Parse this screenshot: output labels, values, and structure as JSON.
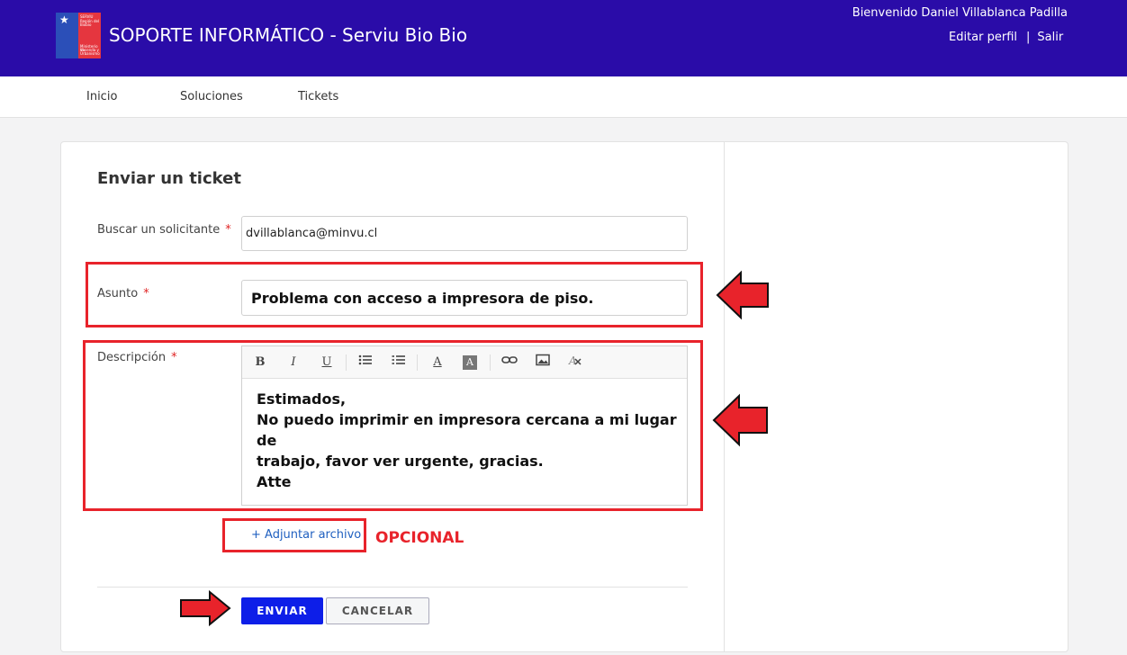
{
  "header": {
    "title": "SOPORTE INFORMÁTICO - Serviu Bio Bio",
    "welcome": "Bienvenido Daniel Villablanca Padilla",
    "edit_profile": "Editar perfil",
    "separator": "|",
    "logout": "Salir",
    "logo_lines": [
      "SERVIU",
      "Región del Biobío",
      "Ministerio de",
      "Vivienda y",
      "Urbanismo"
    ],
    "colors": {
      "bar": "#2a0ca8",
      "logo_blue": "#2b4fb8",
      "logo_red": "#e5363f"
    }
  },
  "nav": {
    "items": [
      "Inicio",
      "Soluciones",
      "Tickets"
    ]
  },
  "form": {
    "title": "Enviar un ticket",
    "required_mark": "*",
    "requester": {
      "label": "Buscar un solicitante",
      "value": "dvillablanca@minvu.cl"
    },
    "subject": {
      "label": "Asunto",
      "value": "Problema con acceso a impresora de piso."
    },
    "description": {
      "label": "Descripción",
      "lines": [
        "Estimados,",
        "No puedo imprimir en impresora cercana a mi lugar de",
        "trabajo, favor ver urgente, gracias.",
        "Atte"
      ]
    },
    "toolbar": {
      "bold": "B",
      "italic": "I",
      "underline": "U",
      "text_color": "A",
      "bg_color": "A"
    },
    "attach_label": "+ Adjuntar archivo",
    "optional_note": "OPCIONAL",
    "send_label": "ENVIAR",
    "cancel_label": "CANCELAR"
  },
  "colors": {
    "accent_button": "#0d1ee8",
    "annotation_red": "#e8232b",
    "link_blue": "#2060c0"
  }
}
